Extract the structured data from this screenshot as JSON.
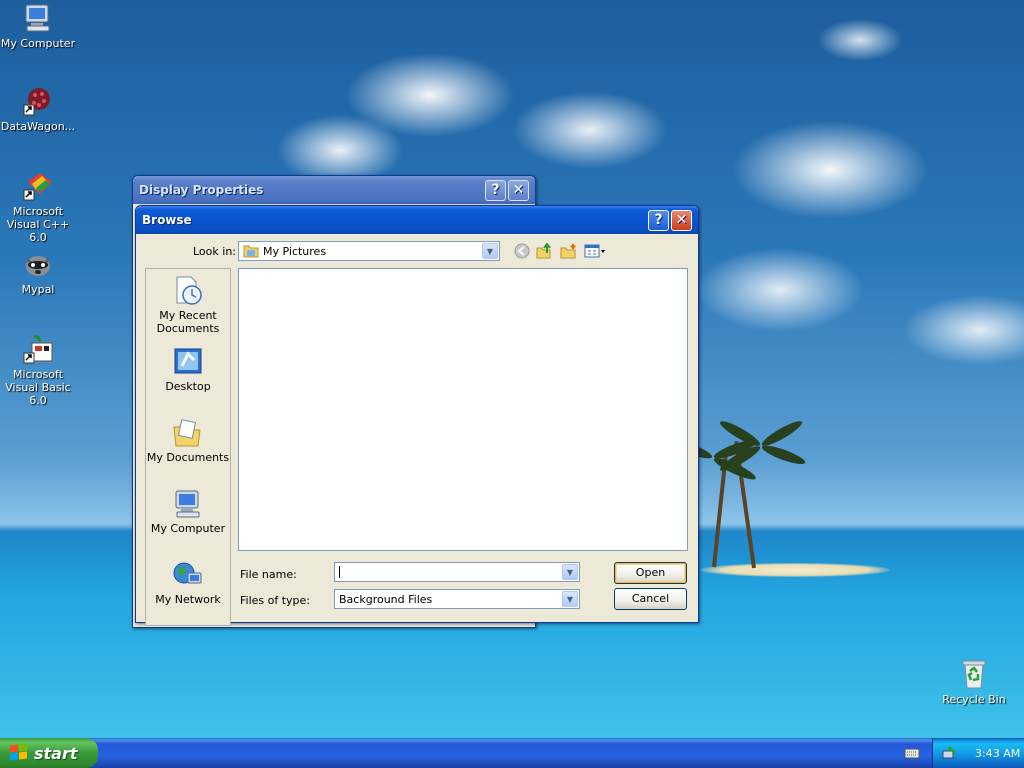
{
  "desktop": {
    "icons": [
      {
        "label": "My Computer"
      },
      {
        "label": "DataWagon..."
      },
      {
        "label": "Microsoft Visual C++ 6.0"
      },
      {
        "label": "Mypal"
      },
      {
        "label": "Microsoft Visual Basic 6.0"
      },
      {
        "label": "Recycle Bin"
      }
    ]
  },
  "display_properties": {
    "title": "Display Properties",
    "help_glyph": "?",
    "close_glyph": "✕"
  },
  "browse": {
    "title": "Browse",
    "help_glyph": "?",
    "close_glyph": "✕",
    "look_in_label": "Look in:",
    "look_in_value": "My Pictures",
    "places": [
      {
        "label": "My Recent Documents"
      },
      {
        "label": "Desktop"
      },
      {
        "label": "My Documents"
      },
      {
        "label": "My Computer"
      },
      {
        "label": "My Network"
      }
    ],
    "file_name_label": "File name:",
    "file_name_value": "",
    "files_of_type_label": "Files of type:",
    "files_of_type_value": "Background Files",
    "open_button": "Open",
    "cancel_button": "Cancel"
  },
  "taskbar": {
    "start_label": "start",
    "clock": "3:43 AM"
  },
  "colors": {
    "title_active": "#0a53cf",
    "start_green": "#3a9a3a",
    "close_red": "#cc3b1d"
  }
}
